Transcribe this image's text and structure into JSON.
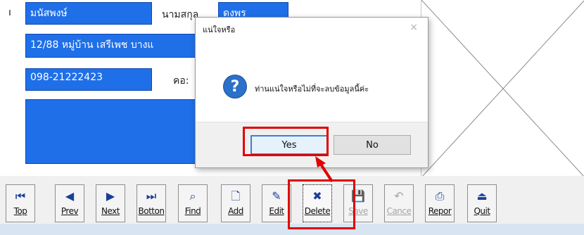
{
  "form": {
    "stub_text": "ı",
    "name_value": "มนัสพงษ์",
    "surname_label": "นามสกุล",
    "surname_value": "ดงพร",
    "address_value": "12/88 หมู่บ้าน เสรีเพช บางแ",
    "phone_value": "098-21222423",
    "next_label": "คอ:",
    "field_color": "#1f6fe8"
  },
  "dialog": {
    "title": "แน่ใจหรือ",
    "close_glyph": "×",
    "icon": "question-icon",
    "icon_glyph": "?",
    "message": "ท่านแน่ใจหรือไม่ที่จะลบข้อมูลนี้ค่ะ",
    "yes_label": "Yes",
    "no_label": "No"
  },
  "toolbar": {
    "buttons": [
      {
        "label": "Top",
        "icon": "first-record-icon",
        "glyph": "⏮"
      },
      {
        "label": "Prev",
        "icon": "previous-record-icon",
        "glyph": "◀"
      },
      {
        "label": "Next",
        "icon": "next-record-icon",
        "glyph": "▶"
      },
      {
        "label": "Botton",
        "icon": "last-record-icon",
        "glyph": "⏭"
      },
      {
        "label": "Find",
        "icon": "binoculars-icon",
        "glyph": "⌕"
      },
      {
        "label": "Add",
        "icon": "new-document-icon",
        "glyph": "🗋"
      },
      {
        "label": "Edit",
        "icon": "edit-icon",
        "glyph": "✎"
      },
      {
        "label": "Delete",
        "icon": "delete-icon",
        "glyph": "✖"
      },
      {
        "label": "Save",
        "icon": "save-icon",
        "glyph": "💾"
      },
      {
        "label": "Cance",
        "icon": "cancel-icon",
        "glyph": "↶"
      },
      {
        "label": "Repor",
        "icon": "printer-icon",
        "glyph": "⎙"
      },
      {
        "label": "Quit",
        "icon": "exit-icon",
        "glyph": "⏏"
      }
    ]
  },
  "colors": {
    "highlight": "#e00000",
    "accent": "#2b70c9"
  }
}
